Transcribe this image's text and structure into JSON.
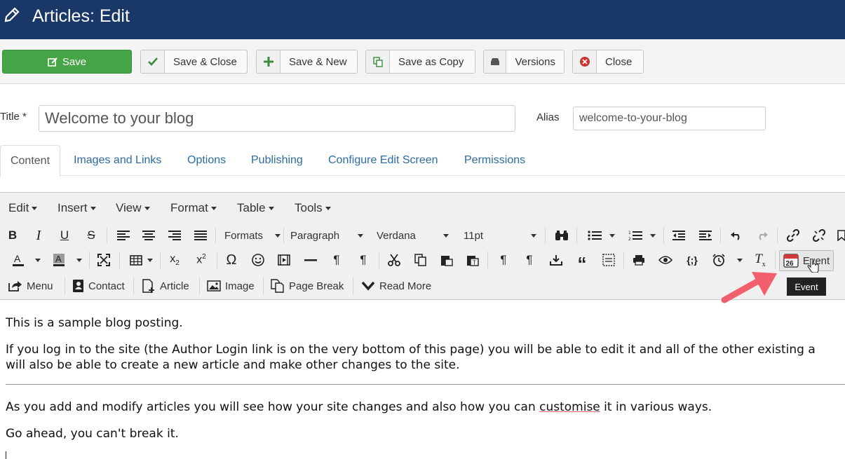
{
  "header": {
    "title": "Articles: Edit",
    "icon": "pencil-icon"
  },
  "toolbar": {
    "save": "Save",
    "save_close": "Save & Close",
    "save_new": "Save & New",
    "save_copy": "Save as Copy",
    "versions": "Versions",
    "close": "Close"
  },
  "form": {
    "title_label": "Title *",
    "title_value": "Welcome to your blog",
    "alias_label": "Alias",
    "alias_value": "welcome-to-your-blog"
  },
  "tabs": [
    "Content",
    "Images and Links",
    "Options",
    "Publishing",
    "Configure Edit Screen",
    "Permissions"
  ],
  "editor": {
    "menus": [
      "Edit",
      "Insert",
      "View",
      "Format",
      "Table",
      "Tools"
    ],
    "formats": "Formats",
    "block": "Paragraph",
    "font": "Verdana",
    "size": "11pt",
    "event_button": "Event",
    "event_day": "26",
    "tooltip": "Event",
    "buttons": [
      "Menu",
      "Contact",
      "Article",
      "Image",
      "Page Break",
      "Read More"
    ]
  },
  "content": {
    "p1": "This is a sample blog posting.",
    "p2_line1": "If you log in to the site (the Author Login link is on the very bottom of this page) you will be able to edit it and all of the other existing a",
    "p2_line2": "will also be able to create a new article and make other changes to the site.",
    "p3_before": "As you add and modify articles you will see how your site changes and also how you can ",
    "p3_word": "customise",
    "p3_after": " it in various ways.",
    "p4": "Go ahead, you can't break it."
  },
  "colors": {
    "header": "#1a3867",
    "save": "#46a546",
    "link": "#2d6ca2",
    "arrow": "#f25f6c"
  }
}
